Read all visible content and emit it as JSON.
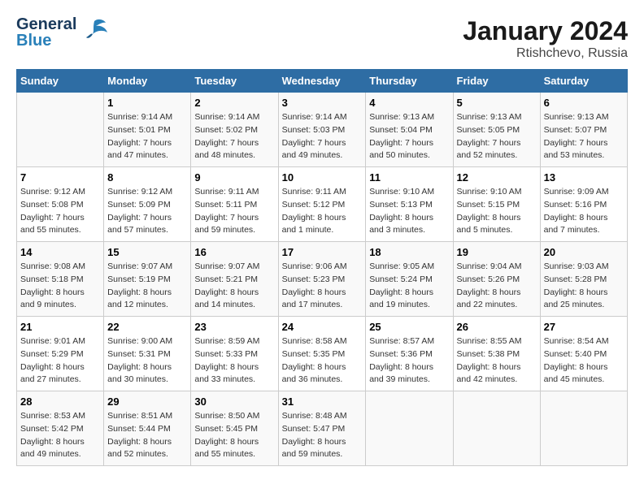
{
  "header": {
    "logo_general": "General",
    "logo_blue": "Blue",
    "title": "January 2024",
    "subtitle": "Rtishchevo, Russia"
  },
  "days_header": [
    "Sunday",
    "Monday",
    "Tuesday",
    "Wednesday",
    "Thursday",
    "Friday",
    "Saturday"
  ],
  "weeks": [
    [
      {
        "num": "",
        "sunrise": "",
        "sunset": "",
        "daylight": ""
      },
      {
        "num": "1",
        "sunrise": "Sunrise: 9:14 AM",
        "sunset": "Sunset: 5:01 PM",
        "daylight": "Daylight: 7 hours and 47 minutes."
      },
      {
        "num": "2",
        "sunrise": "Sunrise: 9:14 AM",
        "sunset": "Sunset: 5:02 PM",
        "daylight": "Daylight: 7 hours and 48 minutes."
      },
      {
        "num": "3",
        "sunrise": "Sunrise: 9:14 AM",
        "sunset": "Sunset: 5:03 PM",
        "daylight": "Daylight: 7 hours and 49 minutes."
      },
      {
        "num": "4",
        "sunrise": "Sunrise: 9:13 AM",
        "sunset": "Sunset: 5:04 PM",
        "daylight": "Daylight: 7 hours and 50 minutes."
      },
      {
        "num": "5",
        "sunrise": "Sunrise: 9:13 AM",
        "sunset": "Sunset: 5:05 PM",
        "daylight": "Daylight: 7 hours and 52 minutes."
      },
      {
        "num": "6",
        "sunrise": "Sunrise: 9:13 AM",
        "sunset": "Sunset: 5:07 PM",
        "daylight": "Daylight: 7 hours and 53 minutes."
      }
    ],
    [
      {
        "num": "7",
        "sunrise": "Sunrise: 9:12 AM",
        "sunset": "Sunset: 5:08 PM",
        "daylight": "Daylight: 7 hours and 55 minutes."
      },
      {
        "num": "8",
        "sunrise": "Sunrise: 9:12 AM",
        "sunset": "Sunset: 5:09 PM",
        "daylight": "Daylight: 7 hours and 57 minutes."
      },
      {
        "num": "9",
        "sunrise": "Sunrise: 9:11 AM",
        "sunset": "Sunset: 5:11 PM",
        "daylight": "Daylight: 7 hours and 59 minutes."
      },
      {
        "num": "10",
        "sunrise": "Sunrise: 9:11 AM",
        "sunset": "Sunset: 5:12 PM",
        "daylight": "Daylight: 8 hours and 1 minute."
      },
      {
        "num": "11",
        "sunrise": "Sunrise: 9:10 AM",
        "sunset": "Sunset: 5:13 PM",
        "daylight": "Daylight: 8 hours and 3 minutes."
      },
      {
        "num": "12",
        "sunrise": "Sunrise: 9:10 AM",
        "sunset": "Sunset: 5:15 PM",
        "daylight": "Daylight: 8 hours and 5 minutes."
      },
      {
        "num": "13",
        "sunrise": "Sunrise: 9:09 AM",
        "sunset": "Sunset: 5:16 PM",
        "daylight": "Daylight: 8 hours and 7 minutes."
      }
    ],
    [
      {
        "num": "14",
        "sunrise": "Sunrise: 9:08 AM",
        "sunset": "Sunset: 5:18 PM",
        "daylight": "Daylight: 8 hours and 9 minutes."
      },
      {
        "num": "15",
        "sunrise": "Sunrise: 9:07 AM",
        "sunset": "Sunset: 5:19 PM",
        "daylight": "Daylight: 8 hours and 12 minutes."
      },
      {
        "num": "16",
        "sunrise": "Sunrise: 9:07 AM",
        "sunset": "Sunset: 5:21 PM",
        "daylight": "Daylight: 8 hours and 14 minutes."
      },
      {
        "num": "17",
        "sunrise": "Sunrise: 9:06 AM",
        "sunset": "Sunset: 5:23 PM",
        "daylight": "Daylight: 8 hours and 17 minutes."
      },
      {
        "num": "18",
        "sunrise": "Sunrise: 9:05 AM",
        "sunset": "Sunset: 5:24 PM",
        "daylight": "Daylight: 8 hours and 19 minutes."
      },
      {
        "num": "19",
        "sunrise": "Sunrise: 9:04 AM",
        "sunset": "Sunset: 5:26 PM",
        "daylight": "Daylight: 8 hours and 22 minutes."
      },
      {
        "num": "20",
        "sunrise": "Sunrise: 9:03 AM",
        "sunset": "Sunset: 5:28 PM",
        "daylight": "Daylight: 8 hours and 25 minutes."
      }
    ],
    [
      {
        "num": "21",
        "sunrise": "Sunrise: 9:01 AM",
        "sunset": "Sunset: 5:29 PM",
        "daylight": "Daylight: 8 hours and 27 minutes."
      },
      {
        "num": "22",
        "sunrise": "Sunrise: 9:00 AM",
        "sunset": "Sunset: 5:31 PM",
        "daylight": "Daylight: 8 hours and 30 minutes."
      },
      {
        "num": "23",
        "sunrise": "Sunrise: 8:59 AM",
        "sunset": "Sunset: 5:33 PM",
        "daylight": "Daylight: 8 hours and 33 minutes."
      },
      {
        "num": "24",
        "sunrise": "Sunrise: 8:58 AM",
        "sunset": "Sunset: 5:35 PM",
        "daylight": "Daylight: 8 hours and 36 minutes."
      },
      {
        "num": "25",
        "sunrise": "Sunrise: 8:57 AM",
        "sunset": "Sunset: 5:36 PM",
        "daylight": "Daylight: 8 hours and 39 minutes."
      },
      {
        "num": "26",
        "sunrise": "Sunrise: 8:55 AM",
        "sunset": "Sunset: 5:38 PM",
        "daylight": "Daylight: 8 hours and 42 minutes."
      },
      {
        "num": "27",
        "sunrise": "Sunrise: 8:54 AM",
        "sunset": "Sunset: 5:40 PM",
        "daylight": "Daylight: 8 hours and 45 minutes."
      }
    ],
    [
      {
        "num": "28",
        "sunrise": "Sunrise: 8:53 AM",
        "sunset": "Sunset: 5:42 PM",
        "daylight": "Daylight: 8 hours and 49 minutes."
      },
      {
        "num": "29",
        "sunrise": "Sunrise: 8:51 AM",
        "sunset": "Sunset: 5:44 PM",
        "daylight": "Daylight: 8 hours and 52 minutes."
      },
      {
        "num": "30",
        "sunrise": "Sunrise: 8:50 AM",
        "sunset": "Sunset: 5:45 PM",
        "daylight": "Daylight: 8 hours and 55 minutes."
      },
      {
        "num": "31",
        "sunrise": "Sunrise: 8:48 AM",
        "sunset": "Sunset: 5:47 PM",
        "daylight": "Daylight: 8 hours and 59 minutes."
      },
      {
        "num": "",
        "sunrise": "",
        "sunset": "",
        "daylight": ""
      },
      {
        "num": "",
        "sunrise": "",
        "sunset": "",
        "daylight": ""
      },
      {
        "num": "",
        "sunrise": "",
        "sunset": "",
        "daylight": ""
      }
    ]
  ]
}
